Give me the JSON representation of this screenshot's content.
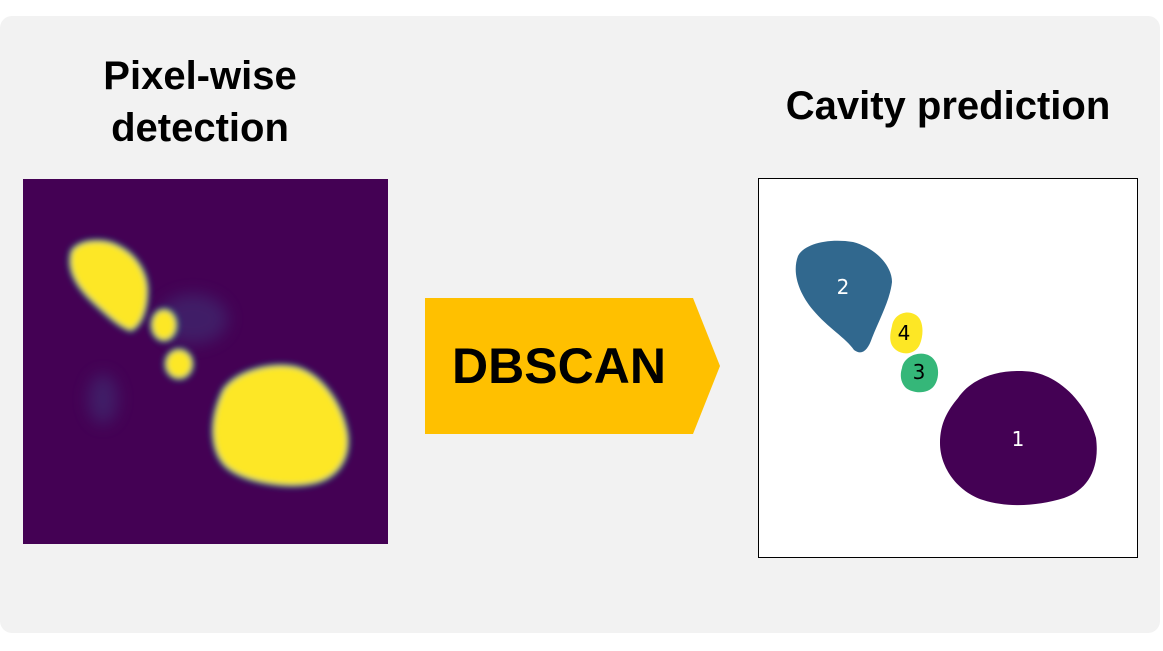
{
  "left_title": "Pixel-wise\ndetection",
  "right_title": "Cavity prediction",
  "method_label": "DBSCAN",
  "colors": {
    "background_panel": "#f2f2f2",
    "heatmap_background": "#440154",
    "heatmap_foreground": "#fde725",
    "arrow": "#ffc000",
    "cluster_1": "#440154",
    "cluster_2": "#31688e",
    "cluster_3": "#35b779",
    "cluster_4": "#fde725"
  },
  "clusters": [
    {
      "id": "1",
      "color": "#440154",
      "label_color": "#ffffff"
    },
    {
      "id": "2",
      "color": "#31688e",
      "label_color": "#ffffff"
    },
    {
      "id": "3",
      "color": "#35b779",
      "label_color": "#000000"
    },
    {
      "id": "4",
      "color": "#fde725",
      "label_color": "#000000"
    }
  ]
}
